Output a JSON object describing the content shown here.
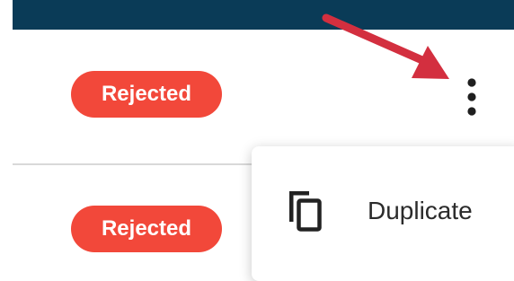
{
  "rows": [
    {
      "status": "Rejected"
    },
    {
      "status": "Rejected"
    }
  ],
  "context_menu": {
    "items": [
      {
        "label": "Duplicate",
        "icon": "duplicate-icon"
      }
    ]
  },
  "row_actions": {
    "icon": "more-vertical-icon"
  },
  "colors": {
    "header_bar": "#0a3b57",
    "status_rejected": "#f2483a",
    "annotation_arrow": "#d32f3f"
  }
}
